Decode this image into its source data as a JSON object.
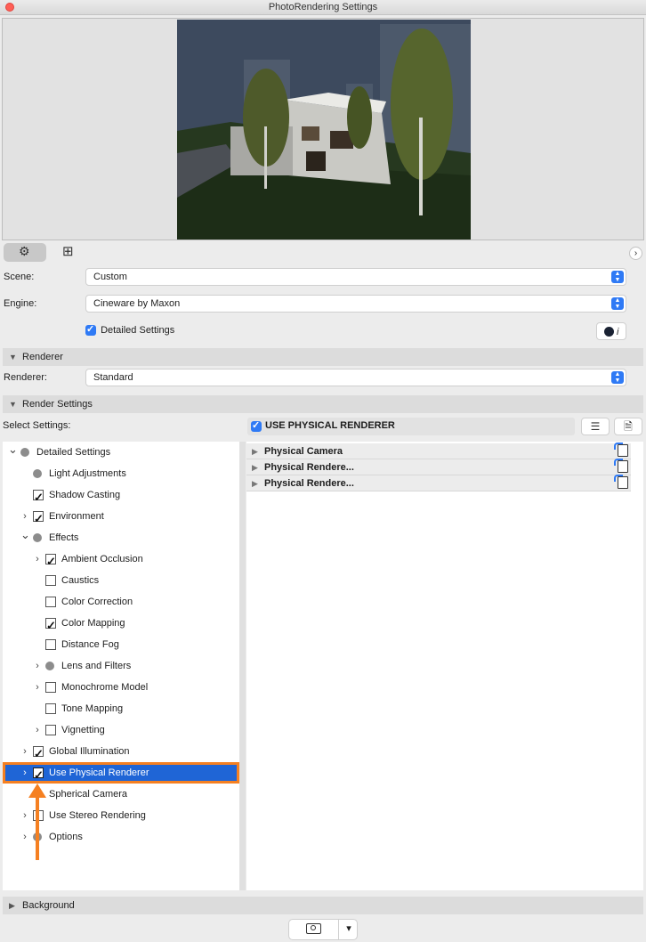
{
  "window": {
    "title": "PhotoRendering Settings"
  },
  "form": {
    "scene_label": "Scene:",
    "scene_value": "Custom",
    "engine_label": "Engine:",
    "engine_value": "Cineware by Maxon",
    "detailed_settings_label": "Detailed Settings",
    "renderer_label": "Renderer:",
    "renderer_value": "Standard"
  },
  "sections": {
    "renderer": "Renderer",
    "render_settings": "Render Settings",
    "background": "Background"
  },
  "select_settings_label": "Select Settings:",
  "use_physical_renderer_header": "USE PHYSICAL RENDERER",
  "tree": [
    {
      "label": "Detailed Settings",
      "level": 0,
      "marker": "dot",
      "expand": "open"
    },
    {
      "label": "Light Adjustments",
      "level": 1,
      "marker": "dot",
      "expand": "none"
    },
    {
      "label": "Shadow Casting",
      "level": 1,
      "marker": "checked",
      "expand": "none"
    },
    {
      "label": "Environment",
      "level": 1,
      "marker": "checked",
      "expand": "closed"
    },
    {
      "label": "Effects",
      "level": 1,
      "marker": "dot",
      "expand": "open"
    },
    {
      "label": "Ambient Occlusion",
      "level": 2,
      "marker": "checked",
      "expand": "closed"
    },
    {
      "label": "Caustics",
      "level": 2,
      "marker": "unchecked",
      "expand": "none"
    },
    {
      "label": "Color Correction",
      "level": 2,
      "marker": "unchecked",
      "expand": "none"
    },
    {
      "label": "Color Mapping",
      "level": 2,
      "marker": "checked",
      "expand": "none"
    },
    {
      "label": "Distance Fog",
      "level": 2,
      "marker": "unchecked",
      "expand": "none"
    },
    {
      "label": "Lens and Filters",
      "level": 2,
      "marker": "dot",
      "expand": "closed"
    },
    {
      "label": "Monochrome Model",
      "level": 2,
      "marker": "unchecked",
      "expand": "closed"
    },
    {
      "label": "Tone Mapping",
      "level": 2,
      "marker": "unchecked",
      "expand": "none"
    },
    {
      "label": "Vignetting",
      "level": 2,
      "marker": "unchecked",
      "expand": "closed"
    },
    {
      "label": "Global Illumination",
      "level": 1,
      "marker": "checked",
      "expand": "closed"
    },
    {
      "label": "Use Physical Renderer",
      "level": 1,
      "marker": "checked",
      "expand": "closed",
      "selected": true
    },
    {
      "label": "Spherical Camera",
      "level": 1,
      "marker": "none",
      "expand": "none"
    },
    {
      "label": "Use Stereo Rendering",
      "level": 1,
      "marker": "unchecked",
      "expand": "closed"
    },
    {
      "label": "Options",
      "level": 1,
      "marker": "dot",
      "expand": "closed"
    }
  ],
  "right_panel": [
    {
      "label": "Physical Camera"
    },
    {
      "label": "Physical Rendere..."
    },
    {
      "label": "Physical Rendere..."
    }
  ],
  "icons": {
    "gear": "⚙",
    "layout": "⊞",
    "expand": "›",
    "cinema_info": "i",
    "camera": "📷",
    "chevron_down": "⌄"
  },
  "colors": {
    "accent": "#2f7af5",
    "selection": "#1f65d6",
    "annotation": "#f58021"
  }
}
